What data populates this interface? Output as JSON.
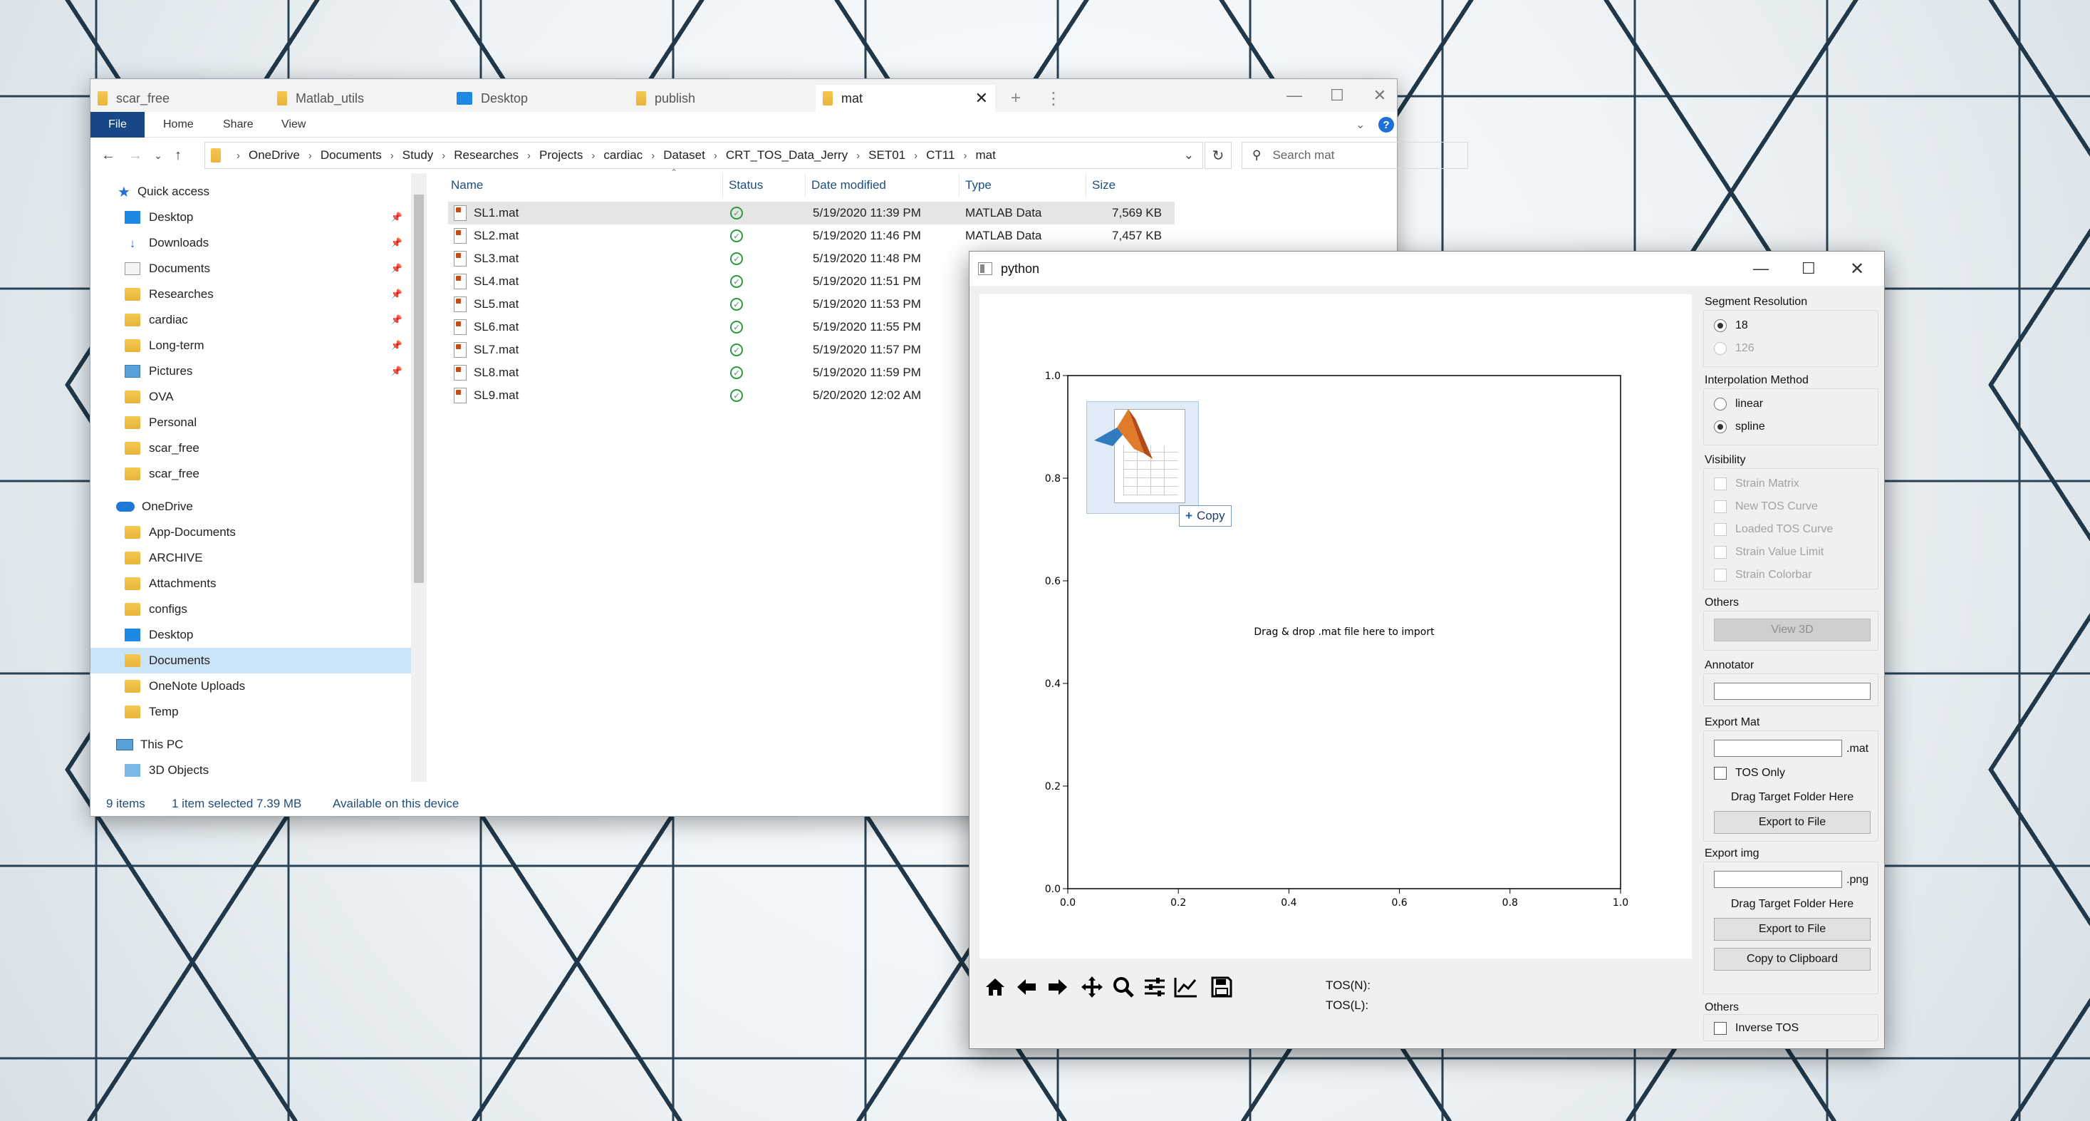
{
  "explorer": {
    "tabs": [
      {
        "label": "scar_free"
      },
      {
        "label": "Matlab_utils"
      },
      {
        "label": "Desktop"
      },
      {
        "label": "publish"
      },
      {
        "label": "mat"
      }
    ],
    "new_tab": "+",
    "tab_menu": "⋮",
    "ribbon": {
      "file": "File",
      "home": "Home",
      "share": "Share",
      "view": "View"
    },
    "breadcrumb": [
      "OneDrive",
      "Documents",
      "Study",
      "Researches",
      "Projects",
      "cardiac",
      "Dataset",
      "CRT_TOS_Data_Jerry",
      "SET01",
      "CT11",
      "mat"
    ],
    "search_placeholder": "Search mat",
    "nav": {
      "quick_access": "Quick access",
      "quick_items": [
        "Desktop",
        "Downloads",
        "Documents",
        "Researches",
        "cardiac",
        "Long-term",
        "Pictures",
        "OVA",
        "Personal",
        "scar_free",
        "scar_free"
      ],
      "onedrive": "OneDrive",
      "onedrive_items": [
        "App-Documents",
        "ARCHIVE",
        "Attachments",
        "configs",
        "Desktop",
        "Documents",
        "OneNote Uploads",
        "Temp"
      ],
      "this_pc": "This PC",
      "pc_items": [
        "3D Objects"
      ]
    },
    "columns": {
      "name": "Name",
      "status": "Status",
      "date": "Date modified",
      "type": "Type",
      "size": "Size"
    },
    "files": [
      {
        "name": "SL1.mat",
        "date": "5/19/2020 11:39 PM",
        "type": "MATLAB Data",
        "size": "7,569 KB"
      },
      {
        "name": "SL2.mat",
        "date": "5/19/2020 11:46 PM",
        "type": "MATLAB Data",
        "size": "7,457 KB"
      },
      {
        "name": "SL3.mat",
        "date": "5/19/2020 11:48 PM"
      },
      {
        "name": "SL4.mat",
        "date": "5/19/2020 11:51 PM"
      },
      {
        "name": "SL5.mat",
        "date": "5/19/2020 11:53 PM"
      },
      {
        "name": "SL6.mat",
        "date": "5/19/2020 11:55 PM"
      },
      {
        "name": "SL7.mat",
        "date": "5/19/2020 11:57 PM"
      },
      {
        "name": "SL8.mat",
        "date": "5/19/2020 11:59 PM"
      },
      {
        "name": "SL9.mat",
        "date": "5/20/2020 12:02 AM"
      }
    ],
    "status": {
      "count": "9 items",
      "selected": "1 item selected  7.39 MB",
      "availability": "Available on this device"
    }
  },
  "python": {
    "title": "python",
    "plot": {
      "drop_hint": "Drag & drop .mat file here to import",
      "copy_label": "Copy",
      "y_ticks": [
        "0.0",
        "0.2",
        "0.4",
        "0.6",
        "0.8",
        "1.0"
      ],
      "x_ticks": [
        "0.0",
        "0.2",
        "0.4",
        "0.6",
        "0.8",
        "1.0"
      ]
    },
    "tos_n": "TOS(N):",
    "tos_l": "TOS(L):",
    "panel": {
      "segment_resolution": {
        "label": "Segment Resolution",
        "options": [
          "18",
          "126"
        ]
      },
      "interpolation": {
        "label": "Interpolation Method",
        "options": [
          "linear",
          "spline"
        ]
      },
      "visibility": {
        "label": "Visibility",
        "options": [
          "Strain Matrix",
          "New TOS Curve",
          "Loaded TOS Curve",
          "Strain Value Limit",
          "Strain Colorbar"
        ]
      },
      "others1": {
        "label": "Others",
        "button": "View 3D"
      },
      "annotator": {
        "label": "Annotator"
      },
      "export_mat": {
        "label": "Export Mat",
        "suffix": ".mat",
        "tos_only": "TOS Only",
        "drag_hint": "Drag Target Folder Here",
        "button": "Export to File"
      },
      "export_img": {
        "label": "Export img",
        "suffix": ".png",
        "drag_hint": "Drag Target Folder Here",
        "button": "Export to File",
        "copy_button": "Copy to Clipboard"
      },
      "others2": {
        "label": "Others",
        "inverse": "Inverse TOS"
      }
    }
  }
}
